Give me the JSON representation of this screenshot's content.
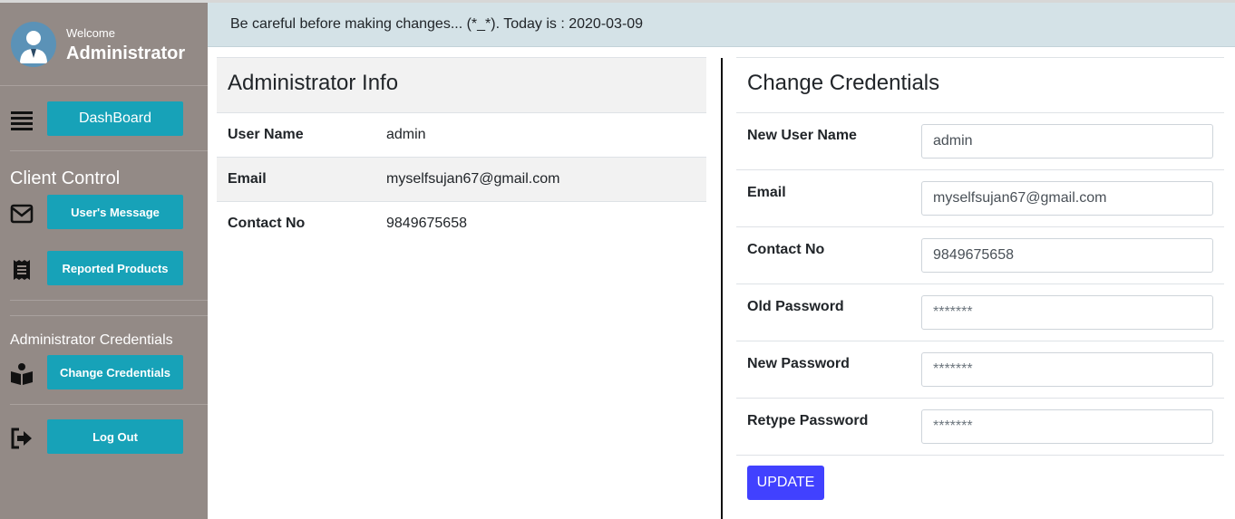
{
  "sidebar": {
    "welcome": "Welcome",
    "user_role": "Administrator",
    "dashboard_label": "DashBoard",
    "client_control_heading": "Client Control",
    "users_message_label": "User's Message",
    "reported_products_label": "Reported Products",
    "admin_credentials_heading": "Administrator Credentials",
    "change_credentials_label": "Change Credentials",
    "logout_label": "Log Out"
  },
  "notice": "Be careful before making changes... (*_*). Today is : 2020-03-09",
  "info": {
    "title": "Administrator Info",
    "rows": [
      {
        "label": "User Name",
        "value": "admin"
      },
      {
        "label": "Email",
        "value": "myselfsujan67@gmail.com"
      },
      {
        "label": "Contact No",
        "value": "9849675658"
      }
    ]
  },
  "credentials": {
    "title": "Change Credentials",
    "fields": [
      {
        "label": "New User Name",
        "value": "admin",
        "placeholder": ""
      },
      {
        "label": "Email",
        "value": "myselfsujan67@gmail.com",
        "placeholder": ""
      },
      {
        "label": "Contact No",
        "value": "9849675658",
        "placeholder": ""
      },
      {
        "label": "Old Password",
        "value": "",
        "placeholder": "*******"
      },
      {
        "label": "New Password",
        "value": "",
        "placeholder": "*******"
      },
      {
        "label": "Retype Password",
        "value": "",
        "placeholder": "*******"
      }
    ],
    "update_label": "UPDATE"
  },
  "colors": {
    "sidebar_bg": "#938a86",
    "button_teal": "#17a2b8",
    "update_blue": "#4141ff",
    "notice_bg": "#d4e2e7"
  }
}
